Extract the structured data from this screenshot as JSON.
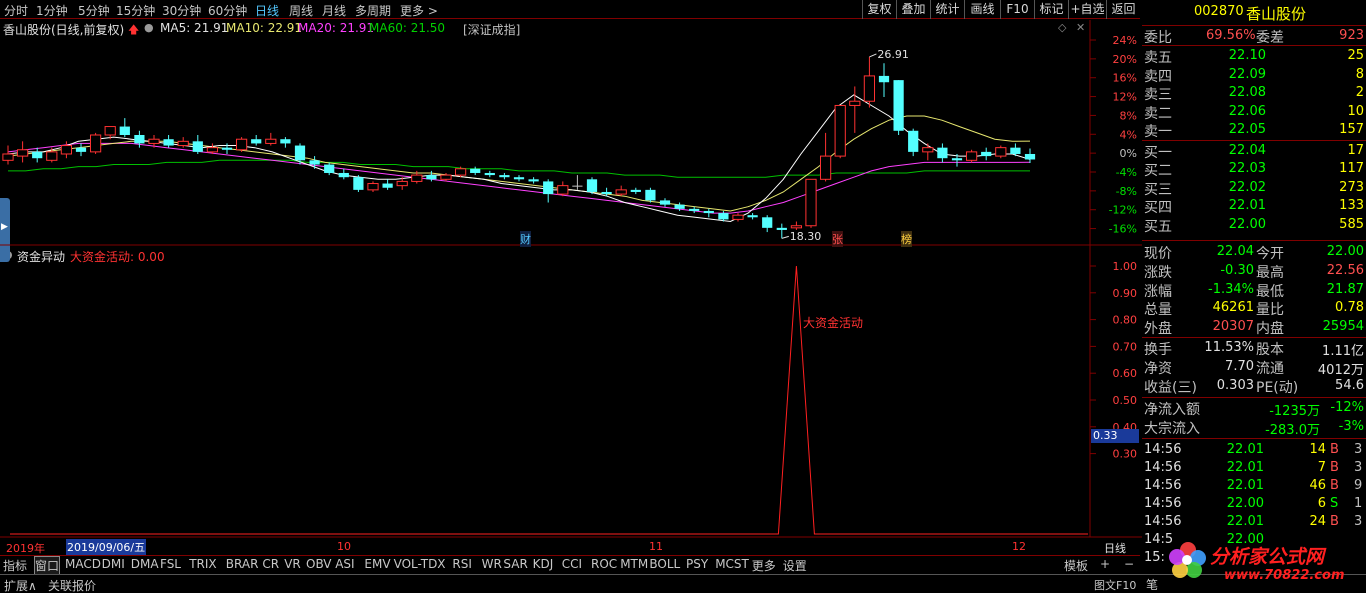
{
  "timeframes": [
    "分时",
    "1分钟",
    "5分钟",
    "15分钟",
    "30分钟",
    "60分钟",
    "日线",
    "周线",
    "月线",
    "多周期",
    "更多 >"
  ],
  "active_tf": "日线",
  "tools": [
    "复权",
    "叠加",
    "统计",
    "画线",
    "F10",
    "标记",
    "+自选",
    "返回"
  ],
  "stock": {
    "code": "002870",
    "name": "香山股份"
  },
  "chart_header": {
    "title": "香山股份(日线,前复权)",
    "ma5": "MA5: 21.91",
    "ma10": "MA10: 22.91",
    "ma20": "MA20: 21.91",
    "ma60": "MA60: 21.50",
    "index": "[深证成指]"
  },
  "markers": {
    "high": "26.91",
    "low": "18.30",
    "cai": "财",
    "zhang": "张",
    "bang": "榜"
  },
  "indicator": {
    "name": "资金异动",
    "line": "大资金活动: 0.00",
    "label": "大资金活动",
    "value_box": "0.33"
  },
  "date_axis": {
    "year": "2019年",
    "selected": "2019/09/06/五",
    "m10": "10",
    "m11": "11",
    "m12": "12",
    "period": "日线"
  },
  "indicators_bar": [
    "指标",
    "窗口",
    "MACD",
    "DMI",
    "DMA",
    "FSL",
    "TRIX",
    "BRAR",
    "CR",
    "VR",
    "OBV",
    "ASI",
    "EMV",
    "VOL-TDX",
    "RSI",
    "WR",
    "SAR",
    "KDJ",
    "CCI",
    "ROC",
    "MTM",
    "BOLL",
    "PSY",
    "MCST",
    "更多",
    "设置"
  ],
  "template_label": "模板",
  "status": {
    "expand": "扩展∧",
    "related": "关联报价",
    "graph": "图文F10",
    "pen": "笔"
  },
  "watermark": {
    "site": "分析家公式网",
    "url": "www.70822.com"
  },
  "colors": {
    "up": "#ff3232",
    "down": "#54ffff",
    "ma5": "#ffffff",
    "ma10": "#e8e870",
    "ma20": "#ff40ff",
    "ma60": "#00c000"
  },
  "chart_data": {
    "type": "candlestick",
    "y_price_range": [
      18.3,
      26.91
    ],
    "percent_ticks": [
      "24%",
      "20%",
      "16%",
      "12%",
      "8%",
      "4%",
      "0%",
      "-4%",
      "-8%",
      "-12%",
      "-16%"
    ],
    "indicator_ticks": [
      "1.00",
      "0.90",
      "0.80",
      "0.70",
      "0.60",
      "0.50",
      "0.40",
      "0.30"
    ],
    "candles": [
      {
        "o": 22.0,
        "c": 22.3,
        "h": 22.7,
        "l": 21.8
      },
      {
        "o": 22.2,
        "c": 22.5,
        "h": 22.9,
        "l": 21.9
      },
      {
        "o": 22.4,
        "c": 22.1,
        "h": 22.6,
        "l": 21.9
      },
      {
        "o": 22.0,
        "c": 22.4,
        "h": 22.6,
        "l": 21.9
      },
      {
        "o": 22.3,
        "c": 22.7,
        "h": 22.9,
        "l": 22.1
      },
      {
        "o": 22.6,
        "c": 22.4,
        "h": 22.8,
        "l": 22.2
      },
      {
        "o": 22.4,
        "c": 23.2,
        "h": 23.3,
        "l": 22.3
      },
      {
        "o": 23.2,
        "c": 23.6,
        "h": 23.6,
        "l": 23.0
      },
      {
        "o": 23.6,
        "c": 23.2,
        "h": 24.0,
        "l": 23.1
      },
      {
        "o": 23.2,
        "c": 22.8,
        "h": 23.4,
        "l": 22.6
      },
      {
        "o": 22.8,
        "c": 23.0,
        "h": 23.2,
        "l": 22.6
      },
      {
        "o": 23.0,
        "c": 22.7,
        "h": 23.2,
        "l": 22.6
      },
      {
        "o": 22.7,
        "c": 22.9,
        "h": 23.1,
        "l": 22.6
      },
      {
        "o": 22.9,
        "c": 22.4,
        "h": 23.2,
        "l": 22.3
      },
      {
        "o": 22.4,
        "c": 22.6,
        "h": 22.8,
        "l": 22.3
      },
      {
        "o": 22.6,
        "c": 22.5,
        "h": 22.8,
        "l": 22.3
      },
      {
        "o": 22.5,
        "c": 23.0,
        "h": 23.1,
        "l": 22.4
      },
      {
        "o": 23.0,
        "c": 22.8,
        "h": 23.2,
        "l": 22.7
      },
      {
        "o": 22.8,
        "c": 23.0,
        "h": 23.3,
        "l": 22.7
      },
      {
        "o": 23.0,
        "c": 22.8,
        "h": 23.1,
        "l": 22.6
      },
      {
        "o": 22.7,
        "c": 22.0,
        "h": 22.8,
        "l": 21.8
      },
      {
        "o": 22.0,
        "c": 21.8,
        "h": 22.2,
        "l": 21.6
      },
      {
        "o": 21.8,
        "c": 21.4,
        "h": 21.9,
        "l": 21.3
      },
      {
        "o": 21.4,
        "c": 21.2,
        "h": 21.6,
        "l": 21.1
      },
      {
        "o": 21.2,
        "c": 20.6,
        "h": 21.3,
        "l": 20.5
      },
      {
        "o": 20.6,
        "c": 20.9,
        "h": 21.0,
        "l": 20.5
      },
      {
        "o": 20.9,
        "c": 20.7,
        "h": 21.1,
        "l": 20.6
      },
      {
        "o": 20.8,
        "c": 21.0,
        "h": 21.2,
        "l": 20.6
      },
      {
        "o": 21.0,
        "c": 21.3,
        "h": 21.5,
        "l": 20.9
      },
      {
        "o": 21.3,
        "c": 21.1,
        "h": 21.5,
        "l": 21.0
      },
      {
        "o": 21.1,
        "c": 21.3,
        "h": 21.4,
        "l": 21.0
      },
      {
        "o": 21.3,
        "c": 21.6,
        "h": 21.7,
        "l": 21.2
      },
      {
        "o": 21.6,
        "c": 21.4,
        "h": 21.7,
        "l": 21.3
      },
      {
        "o": 21.4,
        "c": 21.3,
        "h": 21.5,
        "l": 21.2
      },
      {
        "o": 21.3,
        "c": 21.2,
        "h": 21.4,
        "l": 21.1
      },
      {
        "o": 21.2,
        "c": 21.1,
        "h": 21.3,
        "l": 21.0
      },
      {
        "o": 21.1,
        "c": 21.0,
        "h": 21.2,
        "l": 20.9
      },
      {
        "o": 21.0,
        "c": 20.4,
        "h": 21.1,
        "l": 20.0
      },
      {
        "o": 20.4,
        "c": 20.8,
        "h": 21.0,
        "l": 20.3
      },
      {
        "o": 20.8,
        "c": 20.8,
        "h": 21.3,
        "l": 20.6
      },
      {
        "o": 21.1,
        "c": 20.5,
        "h": 21.2,
        "l": 20.4
      },
      {
        "o": 20.5,
        "c": 20.4,
        "h": 20.7,
        "l": 20.3
      },
      {
        "o": 20.4,
        "c": 20.6,
        "h": 20.8,
        "l": 20.3
      },
      {
        "o": 20.6,
        "c": 20.5,
        "h": 20.7,
        "l": 20.4
      },
      {
        "o": 20.6,
        "c": 20.1,
        "h": 20.7,
        "l": 20.0
      },
      {
        "o": 20.1,
        "c": 19.9,
        "h": 20.2,
        "l": 19.8
      },
      {
        "o": 19.9,
        "c": 19.7,
        "h": 20.0,
        "l": 19.6
      },
      {
        "o": 19.7,
        "c": 19.6,
        "h": 19.8,
        "l": 19.5
      },
      {
        "o": 19.6,
        "c": 19.5,
        "h": 19.7,
        "l": 19.3
      },
      {
        "o": 19.5,
        "c": 19.2,
        "h": 19.6,
        "l": 19.1
      },
      {
        "o": 19.2,
        "c": 19.4,
        "h": 19.5,
        "l": 19.1
      },
      {
        "o": 19.4,
        "c": 19.3,
        "h": 19.5,
        "l": 19.2
      },
      {
        "o": 19.3,
        "c": 18.8,
        "h": 19.4,
        "l": 18.6
      },
      {
        "o": 18.8,
        "c": 18.7,
        "h": 19.0,
        "l": 18.3
      },
      {
        "o": 18.8,
        "c": 18.9,
        "h": 19.1,
        "l": 18.7
      },
      {
        "o": 18.9,
        "c": 21.1,
        "h": 21.1,
        "l": 18.8
      },
      {
        "o": 21.1,
        "c": 22.2,
        "h": 23.3,
        "l": 21.0
      },
      {
        "o": 22.2,
        "c": 24.6,
        "h": 24.6,
        "l": 22.1
      },
      {
        "o": 24.6,
        "c": 24.8,
        "h": 25.5,
        "l": 23.3
      },
      {
        "o": 24.8,
        "c": 26.0,
        "h": 26.9,
        "l": 24.5
      },
      {
        "o": 26.0,
        "c": 25.7,
        "h": 26.6,
        "l": 25.0
      },
      {
        "o": 25.8,
        "c": 23.4,
        "h": 25.8,
        "l": 23.2
      },
      {
        "o": 23.4,
        "c": 22.4,
        "h": 23.5,
        "l": 22.2
      },
      {
        "o": 22.4,
        "c": 22.6,
        "h": 22.8,
        "l": 22.0
      },
      {
        "o": 22.6,
        "c": 22.1,
        "h": 22.8,
        "l": 21.9
      },
      {
        "o": 22.1,
        "c": 22.0,
        "h": 22.3,
        "l": 21.7
      },
      {
        "o": 22.0,
        "c": 22.4,
        "h": 22.5,
        "l": 21.9
      },
      {
        "o": 22.4,
        "c": 22.2,
        "h": 22.6,
        "l": 22.0
      },
      {
        "o": 22.2,
        "c": 22.6,
        "h": 22.7,
        "l": 22.1
      },
      {
        "o": 22.6,
        "c": 22.3,
        "h": 22.8,
        "l": 22.2
      },
      {
        "o": 22.3,
        "c": 22.04,
        "h": 22.56,
        "l": 21.87
      }
    ],
    "ma5": [
      22.3,
      22.4,
      22.4,
      22.6,
      22.9,
      23.0,
      23.1,
      23.0,
      22.9,
      22.8,
      22.7,
      22.6,
      22.7,
      22.7,
      22.6,
      22.4,
      22.1,
      21.8,
      21.5,
      21.3,
      21.2,
      21.1,
      21.1,
      21.2,
      21.3,
      21.3,
      21.2,
      21.1,
      20.9,
      20.8,
      20.7,
      20.6,
      20.6,
      20.5,
      20.3,
      20.0,
      19.8,
      19.6,
      19.4,
      19.3,
      19.2,
      19.1,
      19.5,
      20.2,
      21.1,
      22.3,
      23.4,
      24.5,
      25.1,
      24.6,
      24.1,
      23.4,
      22.8,
      22.3,
      22.2,
      22.2,
      22.3,
      22.3,
      22.04
    ],
    "ma10": [
      22.2,
      22.3,
      22.4,
      22.5,
      22.6,
      22.7,
      22.8,
      22.9,
      22.9,
      22.9,
      22.8,
      22.7,
      22.6,
      22.5,
      22.4,
      22.3,
      22.2,
      22.1,
      21.9,
      21.8,
      21.7,
      21.6,
      21.5,
      21.4,
      21.4,
      21.3,
      21.2,
      21.1,
      21.0,
      20.9,
      20.8,
      20.7,
      20.6,
      20.5,
      20.4,
      20.3,
      20.1,
      20.0,
      19.9,
      19.8,
      19.7,
      19.6,
      19.8,
      20.1,
      20.5,
      21.1,
      21.7,
      22.4,
      23.0,
      23.5,
      23.9,
      24.1,
      24.1,
      23.9,
      23.6,
      23.3,
      23.0,
      22.9,
      22.91
    ],
    "ma20": [
      22.4,
      22.5,
      22.6,
      22.7,
      22.8,
      22.8,
      22.8,
      22.8,
      22.7,
      22.6,
      22.5,
      22.4,
      22.3,
      22.2,
      22.1,
      22.0,
      21.9,
      21.8,
      21.7,
      21.6,
      21.5,
      21.4,
      21.3,
      21.2,
      21.1,
      21.0,
      20.9,
      20.8,
      20.7,
      20.6,
      20.5,
      20.4,
      20.3,
      20.2,
      20.1,
      20.0,
      19.9,
      19.8,
      19.7,
      19.6,
      19.5,
      19.5,
      19.6,
      19.8,
      20.0,
      20.3,
      20.6,
      20.9,
      21.2,
      21.5,
      21.7,
      21.8,
      21.9,
      21.9,
      21.9,
      21.9,
      21.9,
      21.9,
      21.91
    ],
    "ma60": [
      21.5,
      21.5,
      21.6,
      21.6,
      21.7,
      21.7,
      21.8,
      21.8,
      21.8,
      21.9,
      21.9,
      21.9,
      22.0,
      22.0,
      22.0,
      22.0,
      22.0,
      21.9,
      21.9,
      21.9,
      21.8,
      21.8,
      21.8,
      21.7,
      21.7,
      21.7,
      21.6,
      21.6,
      21.6,
      21.5,
      21.5,
      21.5,
      21.4,
      21.4,
      21.4,
      21.3,
      21.3,
      21.3,
      21.2,
      21.2,
      21.2,
      21.2,
      21.2,
      21.2,
      21.3,
      21.3,
      21.3,
      21.4,
      21.4,
      21.4,
      21.4,
      21.4,
      21.5,
      21.5,
      21.5,
      21.5,
      21.5,
      21.5,
      21.5
    ],
    "indicator_spike": {
      "index": 54,
      "value": 1.0
    }
  },
  "quote": {
    "weibi_label": "委比",
    "weibi": "69.56%",
    "weicha_label": "委差",
    "weicha": "923",
    "sell": [
      {
        "label": "卖五",
        "price": "22.10",
        "vol": "25"
      },
      {
        "label": "卖四",
        "price": "22.09",
        "vol": "8"
      },
      {
        "label": "卖三",
        "price": "22.08",
        "vol": "2"
      },
      {
        "label": "卖二",
        "price": "22.06",
        "vol": "10"
      },
      {
        "label": "卖一",
        "price": "22.05",
        "vol": "157"
      }
    ],
    "buy": [
      {
        "label": "买一",
        "price": "22.04",
        "vol": "17"
      },
      {
        "label": "买二",
        "price": "22.03",
        "vol": "117"
      },
      {
        "label": "买三",
        "price": "22.02",
        "vol": "273"
      },
      {
        "label": "买四",
        "price": "22.01",
        "vol": "133"
      },
      {
        "label": "买五",
        "price": "22.00",
        "vol": "585"
      }
    ],
    "stats": [
      {
        "l1": "现价",
        "v1": "22.04",
        "c1": "#00ff00",
        "l2": "今开",
        "v2": "22.00",
        "c2": "#00ff00"
      },
      {
        "l1": "涨跌",
        "v1": "-0.30",
        "c1": "#00ff00",
        "l2": "最高",
        "v2": "22.56",
        "c2": "#ff5050"
      },
      {
        "l1": "涨幅",
        "v1": "-1.34%",
        "c1": "#00ff00",
        "l2": "最低",
        "v2": "21.87",
        "c2": "#00ff00"
      },
      {
        "l1": "总量",
        "v1": "46261",
        "c1": "#ffff00",
        "l2": "量比",
        "v2": "0.78",
        "c2": "#ffff00"
      },
      {
        "l1": "外盘",
        "v1": "20307",
        "c1": "#ff5050",
        "l2": "内盘",
        "v2": "25954",
        "c2": "#00ff00"
      }
    ],
    "stats2": [
      {
        "l1": "换手",
        "v1": "11.53%",
        "l2": "股本",
        "v2": "1.11亿"
      },
      {
        "l1": "净资",
        "v1": "7.70",
        "l2": "流通",
        "v2": "4012万"
      },
      {
        "l1": "收益(三)",
        "v1": "0.303",
        "l2": "PE(动)",
        "v2": "54.6"
      }
    ],
    "flow": [
      {
        "label": "净流入额",
        "value": "-1235万",
        "pct": "-12%"
      },
      {
        "label": "大宗流入",
        "value": "-283.0万",
        "pct": "-3%"
      }
    ],
    "ticks": [
      {
        "time": "14:56",
        "price": "22.01",
        "vol": "14",
        "bs": "B",
        "n": "3"
      },
      {
        "time": "14:56",
        "price": "22.01",
        "vol": "7",
        "bs": "B",
        "n": "3"
      },
      {
        "time": "14:56",
        "price": "22.01",
        "vol": "46",
        "bs": "B",
        "n": "9"
      },
      {
        "time": "14:56",
        "price": "22.00",
        "vol": "6",
        "bs": "S",
        "n": "1"
      },
      {
        "time": "14:56",
        "price": "22.01",
        "vol": "24",
        "bs": "B",
        "n": "3"
      },
      {
        "time": "14:5",
        "price": "22.00",
        "vol": "",
        "bs": "",
        "n": ""
      },
      {
        "time": "15:",
        "price": "",
        "vol": "",
        "bs": "",
        "n": ""
      }
    ]
  }
}
